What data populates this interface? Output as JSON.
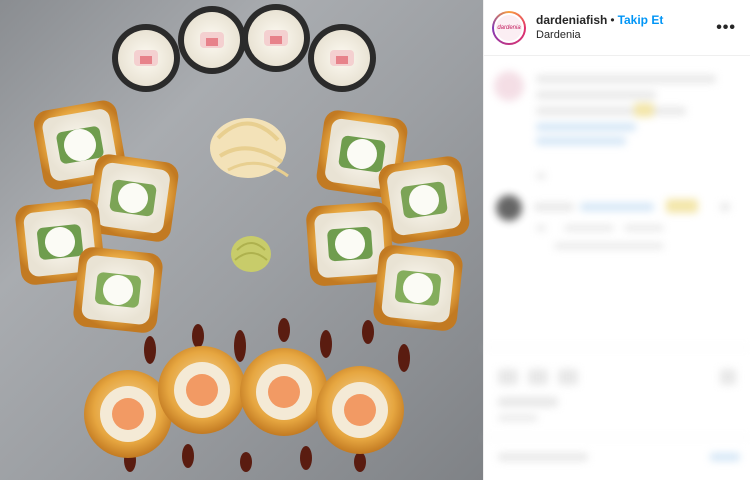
{
  "post": {
    "username": "dardeniafish",
    "separator": "•",
    "follow_label": "Takip Et",
    "location": "Dardenia",
    "more_icon": "more-horizontal-icon",
    "avatar_text": "dardenia"
  },
  "colors": {
    "follow": "#0095f6",
    "text": "#262626",
    "divider": "#efefef"
  }
}
